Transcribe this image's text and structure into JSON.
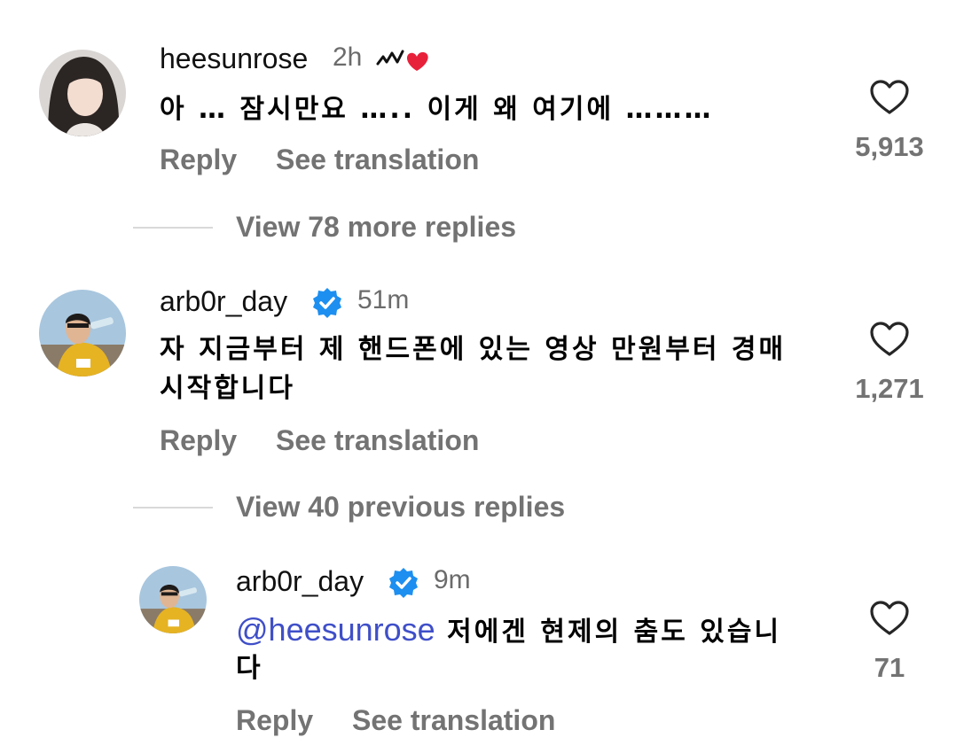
{
  "comments": [
    {
      "username": "heesunrose",
      "time": "2h",
      "text": "아 … 잠시만요 ….. 이게 왜 여기에 ………",
      "reply_label": "Reply",
      "translate_label": "See translation",
      "like_count": "5,913",
      "badge_icon": "heart-sticker-icon"
    },
    {
      "username": "arb0r_day",
      "time": "51m",
      "text_line1": "자 지금부터 제 핸드폰에 있는 영상 만원부터 경매",
      "text_line2": "시작합니다",
      "reply_label": "Reply",
      "translate_label": "See translation",
      "like_count": "1,271",
      "verified_icon": "verified-badge-icon"
    },
    {
      "username": "arb0r_day",
      "time": "9m",
      "mention": "@heesunrose",
      "text_line1": "저에겐 현제의 춤도 있습니",
      "text_line2": "다",
      "reply_label": "Reply",
      "translate_label": "See translation",
      "like_count": "71",
      "verified_icon": "verified-badge-icon"
    }
  ],
  "threads": {
    "more_replies": "View 78 more replies",
    "previous_replies": "View 40 previous replies"
  },
  "colors": {
    "verified": "#1d8ff0",
    "mention": "#3f4fc8",
    "muted": "#737373"
  }
}
